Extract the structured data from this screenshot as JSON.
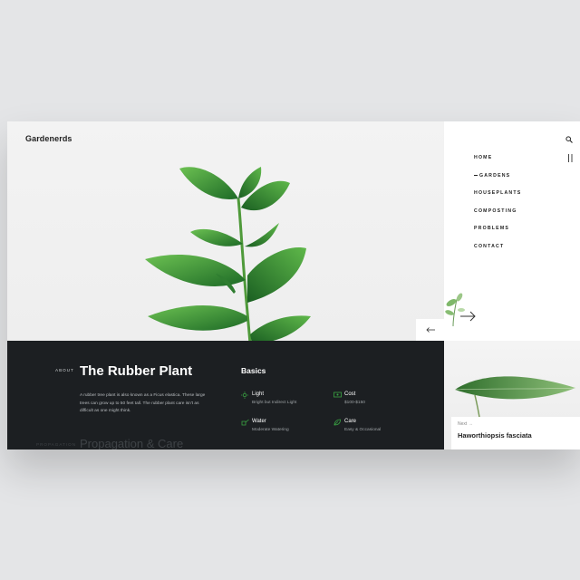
{
  "brand": "Gardenerds",
  "nav": {
    "items": [
      {
        "label": "HOME",
        "active": false
      },
      {
        "label": "GARDENS",
        "active": true
      },
      {
        "label": "HOUSEPLANTS",
        "active": false
      },
      {
        "label": "COMPOSTING",
        "active": false
      },
      {
        "label": "PROBLEMS",
        "active": false
      },
      {
        "label": "CONTACT",
        "active": false
      }
    ]
  },
  "about": {
    "label": "ABOUT",
    "title": "The Rubber Plant",
    "description": "A rubber tree plant is also known as a Ficus elastica. These large trees can grow up to 50 feet tall. The rubber plant care isn't as difficult as one might think."
  },
  "next_section": {
    "label": "PROPAGATION",
    "heading": "Propagation & Care"
  },
  "basics": {
    "title": "Basics",
    "facts": [
      {
        "icon": "sun-icon",
        "label": "Light",
        "value": "Bright but Indirect Light"
      },
      {
        "icon": "cash-icon",
        "label": "Cost",
        "value": "$100-$150"
      },
      {
        "icon": "watering-can-icon",
        "label": "Water",
        "value": "Moderate Watering"
      },
      {
        "icon": "leaf-icon",
        "label": "Care",
        "value": "Easy & Occasional"
      }
    ]
  },
  "next_plant": {
    "label": "Next  →",
    "title": "Haworthiopsis fasciata"
  },
  "colors": {
    "dark_panel": "#1c1f22",
    "accent_green": "#3aa543",
    "leaf_dark": "#1f6b27",
    "leaf_light": "#5fbd4c"
  }
}
